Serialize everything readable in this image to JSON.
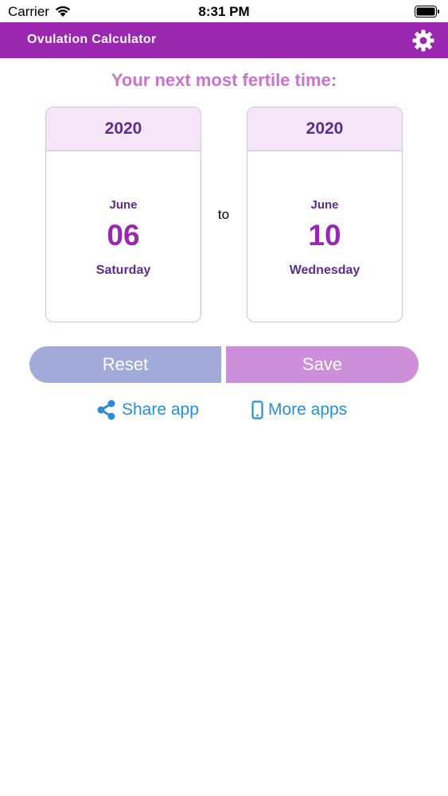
{
  "status_bar": {
    "carrier": "Carrier",
    "time": "8:31 PM"
  },
  "nav": {
    "title": "Ovulation Calculator",
    "settings_icon": "gear-icon"
  },
  "headline": "Your next most fertile time:",
  "start_date": {
    "year": "2020",
    "month": "June",
    "day": "06",
    "weekday": "Saturday"
  },
  "separator": "to",
  "end_date": {
    "year": "2020",
    "month": "June",
    "day": "10",
    "weekday": "Wednesday"
  },
  "buttons": {
    "reset_label": "Reset",
    "save_label": "Save"
  },
  "links": {
    "share_label": "Share app",
    "more_label": "More apps"
  },
  "colors": {
    "nav_background": "#9b27b0",
    "headline": "#c873cc",
    "reset_button": "#a2aad9",
    "save_button": "#cd8fd9",
    "link": "#2a8dd8"
  }
}
